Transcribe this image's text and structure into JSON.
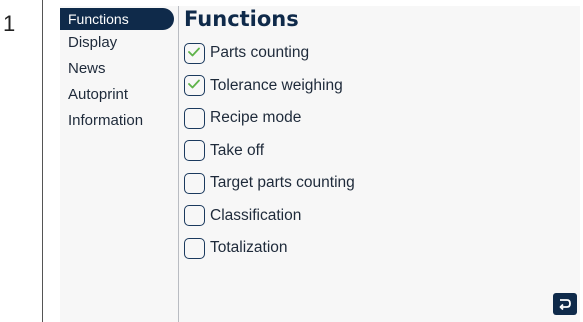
{
  "step": {
    "number": "1"
  },
  "sidebar": {
    "items": [
      {
        "label": "Functions",
        "active": true
      },
      {
        "label": "Display",
        "active": false
      },
      {
        "label": "News",
        "active": false
      },
      {
        "label": "Autoprint",
        "active": false
      },
      {
        "label": "Information",
        "active": false
      }
    ]
  },
  "main": {
    "title": "Functions",
    "options": [
      {
        "label": "Parts counting",
        "checked": true
      },
      {
        "label": "Tolerance weighing",
        "checked": true
      },
      {
        "label": "Recipe mode",
        "checked": false
      },
      {
        "label": "Take off",
        "checked": false
      },
      {
        "label": "Target parts counting",
        "checked": false
      },
      {
        "label": "Classification",
        "checked": false
      },
      {
        "label": "Totalization",
        "checked": false
      }
    ]
  },
  "footer": {
    "back_icon": "return-icon"
  },
  "colors": {
    "navy": "#0f2a4a",
    "check_green": "#5fb34a",
    "background": "#f7f7f7"
  }
}
